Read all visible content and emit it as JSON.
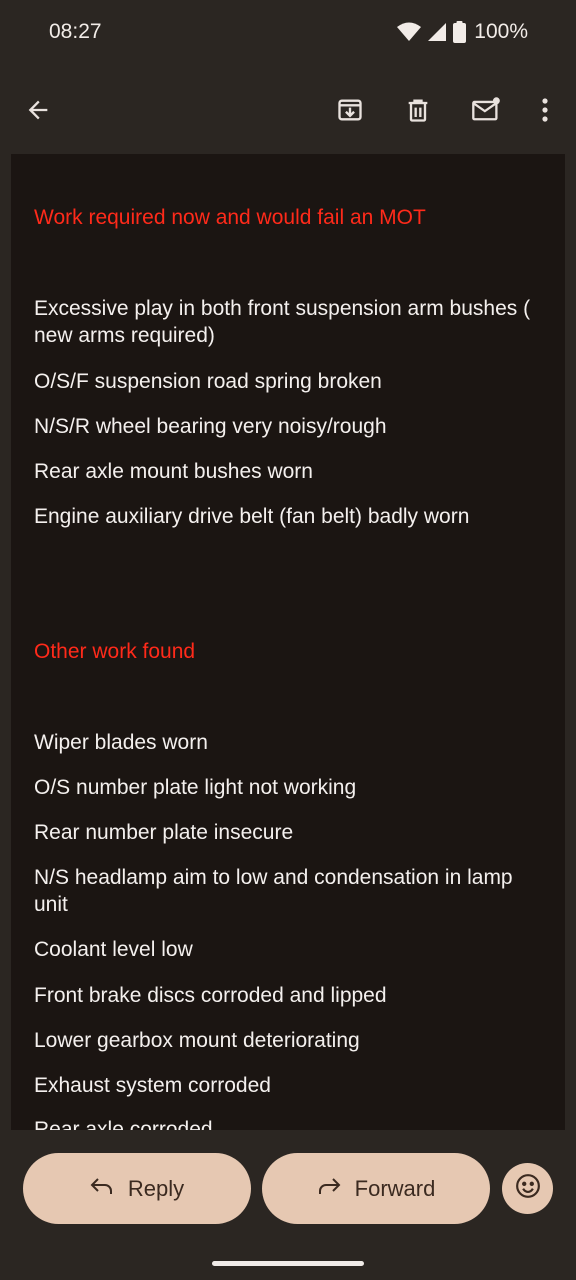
{
  "status": {
    "time": "08:27",
    "battery": "100%"
  },
  "email": {
    "section1_title": "Work required now and would fail an MOT",
    "section1_items": [
      "Excessive play in both front suspension arm bushes ( new arms required)",
      "O/S/F suspension road spring broken",
      "N/S/R wheel bearing very noisy/rough",
      "Rear axle mount bushes worn",
      "Engine auxiliary drive belt (fan belt) badly worn"
    ],
    "section2_title": "Other work found",
    "section2_items": [
      "Wiper blades worn",
      "O/S number plate light not working",
      "Rear number plate insecure",
      "N/S headlamp aim to low and condensation in lamp unit",
      "Coolant level low",
      "Front brake discs corroded and lipped",
      "Lower gearbox mount deteriorating",
      "Exhaust system corroded",
      "Rear axle corroded"
    ]
  },
  "actions": {
    "reply_label": "Reply",
    "forward_label": "Forward"
  },
  "icons": {
    "back": "arrow-back-icon",
    "archive": "archive-icon",
    "delete": "trash-icon",
    "unread": "mark-unread-icon",
    "more": "more-vert-icon",
    "emoji": "emoji-icon"
  },
  "colors": {
    "accent_red": "#ff2a1a",
    "pill": "#e6c8b2",
    "bg": "#2b2622",
    "content_bg": "#1b1512"
  }
}
